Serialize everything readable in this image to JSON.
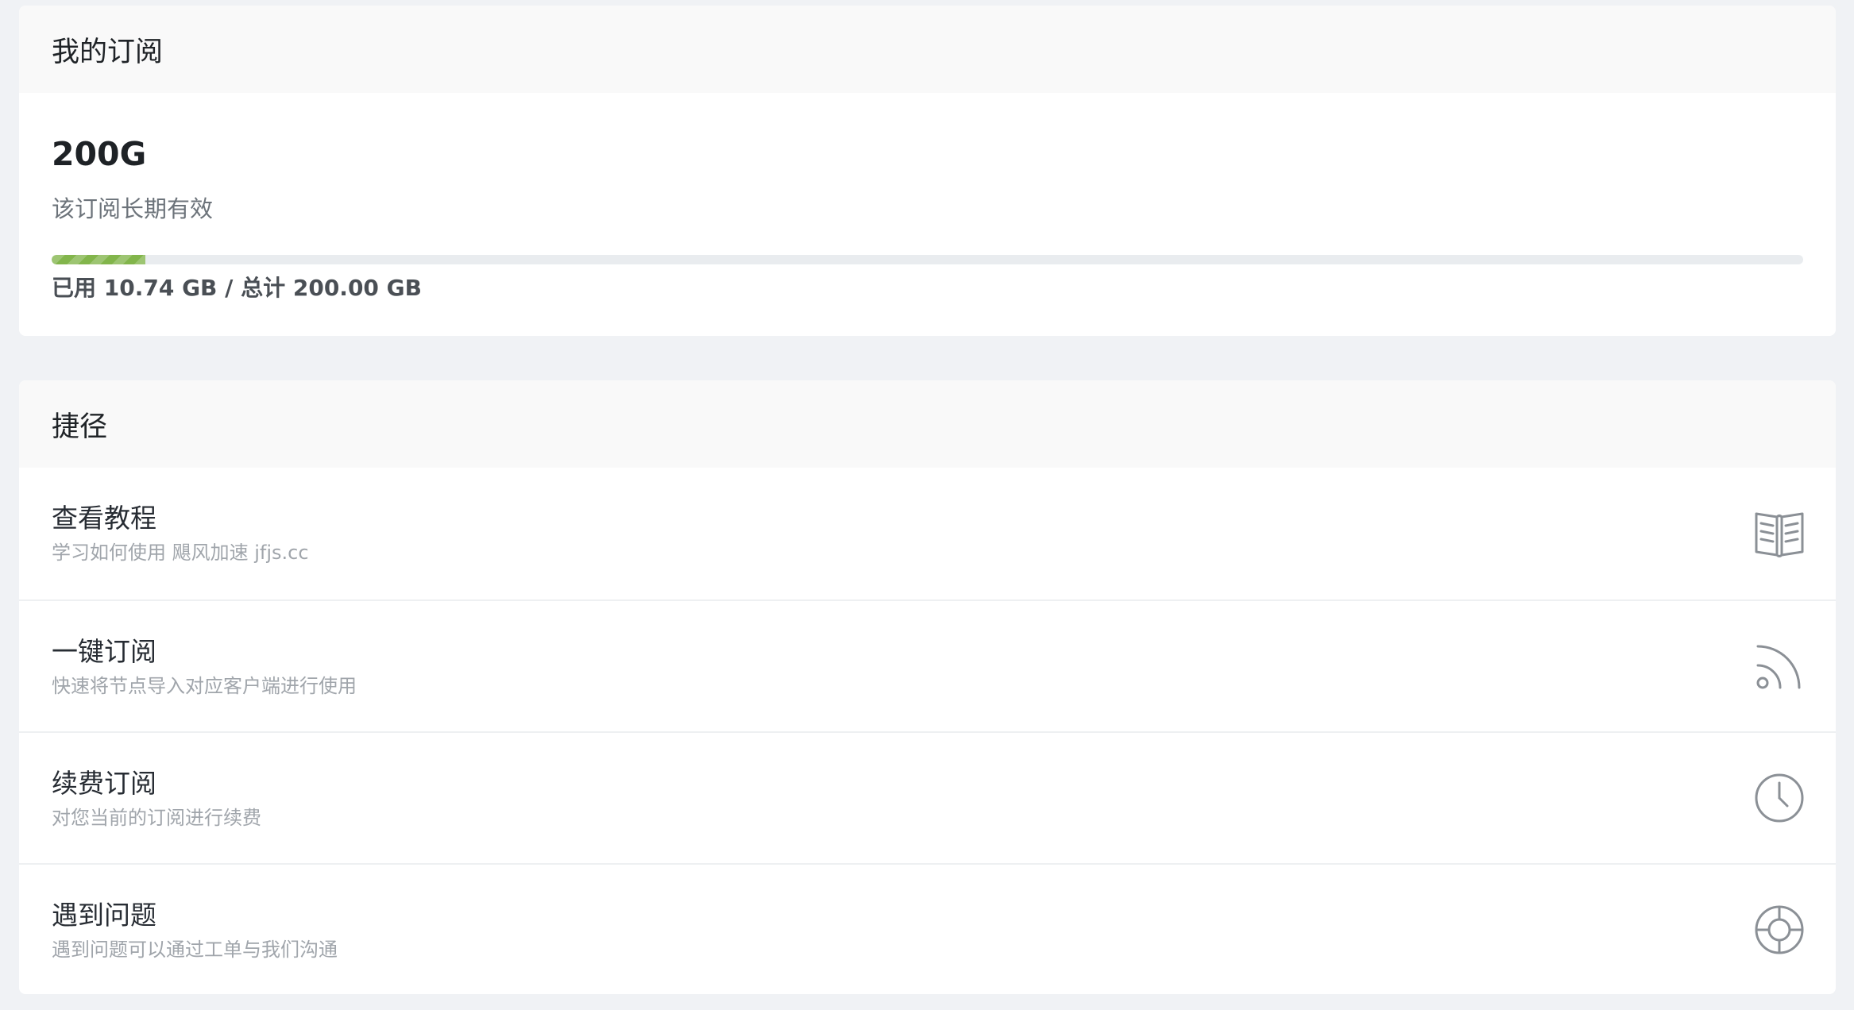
{
  "subscription": {
    "header": "我的订阅",
    "plan_name": "200G",
    "validity": "该订阅长期有效",
    "usage_text": "已用 10.74 GB / 总计 200.00 GB",
    "used_gb": 10.74,
    "total_gb": 200.0,
    "progress_fraction": 0.0537,
    "progress_color": "#82b54b"
  },
  "shortcuts": {
    "header": "捷径",
    "items": [
      {
        "title": "查看教程",
        "desc": "学习如何使用 飓风加速 jfjs.cc",
        "icon": "book-open-icon"
      },
      {
        "title": "一键订阅",
        "desc": "快速将节点导入对应客户端进行使用",
        "icon": "rss-feed-icon"
      },
      {
        "title": "续费订阅",
        "desc": "对您当前的订阅进行续费",
        "icon": "clock-icon"
      },
      {
        "title": "遇到问题",
        "desc": "遇到问题可以通过工单与我们沟通",
        "icon": "lifebuoy-icon"
      }
    ]
  }
}
